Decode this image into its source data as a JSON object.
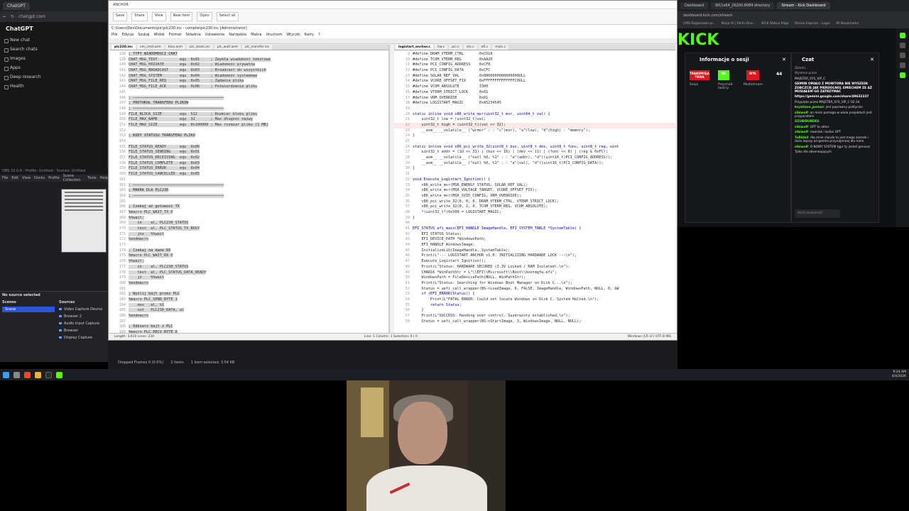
{
  "chatgpt": {
    "tab_title": "ChatGPT",
    "url": "chatgpt.com",
    "brand": "ChatGPT",
    "nav": [
      "New chat",
      "Search chats",
      "Images",
      "Apps",
      "Deep research",
      "Health"
    ]
  },
  "obs": {
    "title": "OBS 32.0.4 - Profile: Untitled - Scenes: Untitled",
    "menu": [
      "File",
      "Edit",
      "View",
      "Docks",
      "Profile",
      "Scene Collection",
      "Tools",
      "Help"
    ],
    "no_source": "No source selected",
    "scenes_header": "Scenes",
    "sources_header": "Sources",
    "scene": "Scene",
    "sources": [
      "Video Capture Device",
      "Browser 2",
      "Audio Input Capture",
      "Browser",
      "Display Capture"
    ],
    "dropped_frames": "Dropped Frames 0 (0.0%)",
    "items": "2 items",
    "selected": "1 item selected, 3.54 KB"
  },
  "notepad": {
    "title": "ANCHOR",
    "path": "C:\\Users\\Dev\\Documents\\plc\\plc230.inc - compile\\plc230.inc [Administrator]",
    "menu": [
      "Plik",
      "Edycja",
      "Szukaj",
      "Widok",
      "Format",
      "Składnia",
      "Ustawienia",
      "Narzędzia",
      "Makra",
      "Uruchom",
      "Wtyczki",
      "Karty",
      "?"
    ],
    "ribbon": [
      "Save",
      "Share",
      "View",
      "New item",
      "Open",
      "Select all"
    ],
    "left_tabs": [
      "plc230.inc",
      "vm_cmd.asm",
      "bios.asm",
      "plc_stack.inc",
      "plc_wait.asm",
      "plc_transfer.inc"
    ],
    "right_tabs": [
      "logistart_anchor.c",
      "hw.c",
      "pci.c",
      "vtx.c",
      "efi.c",
      "main.c"
    ],
    "left_lines": [
      {
        "n": "138",
        "t": "; TYPY WIADOMOŚCI CHAT",
        "c": true
      },
      {
        "n": "139",
        "t": "CHAT_MSG_TEXT          equ  0x01     ; Zwykła wiadomość tekstowa"
      },
      {
        "n": "140",
        "t": "CHAT_MSG_PRIVATE       equ  0x02     ; Wiadomość prywatna"
      },
      {
        "n": "141",
        "t": "CHAT_MSG_BROADCAST     equ  0x03     ; Broadcast do wszystkich"
      },
      {
        "n": "142",
        "t": "CHAT_MSG_SYSTEM        equ  0x04     ; Wiadomość systemowa"
      },
      {
        "n": "143",
        "t": "CHAT_MSG_FILE_REQ      equ  0x05     ; Żądanie pliku"
      },
      {
        "n": "144",
        "t": "CHAT_MSG_FILE_ACK      equ  0x06     ; Potwierdzenie pliku"
      },
      {
        "n": "145",
        "t": ""
      },
      {
        "n": "146",
        "t": "; ─────────────────────────────────────────"
      },
      {
        "n": "147",
        "t": "; PROTOKÓŁ TRANSFERU PLIKÓW",
        "c": true
      },
      {
        "n": "148",
        "t": "; ─────────────────────────────────────────"
      },
      {
        "n": "149",
        "t": "FILE_BLOCK_SIZE        equ  512      ; Rozmiar bloku pliku"
      },
      {
        "n": "150",
        "t": "FILE_MAX_NAME          equ  32       ; Max długość nazwy"
      },
      {
        "n": "151",
        "t": "FILE_MAX_SIZE          equ  0x100000 ; Max rozmiar pliku (1 MB)"
      },
      {
        "n": "152",
        "t": ""
      },
      {
        "n": "153",
        "t": "; KODY STATUSU TRANSFERU PLIKU",
        "c": true
      },
      {
        "n": "154",
        "t": ""
      },
      {
        "n": "155",
        "t": "FILE_STATUS_READY      equ  0x00"
      },
      {
        "n": "156",
        "t": "FILE_STATUS_SENDING    equ  0x01"
      },
      {
        "n": "157",
        "t": "FILE_STATUS_RECEIVING  equ  0x02"
      },
      {
        "n": "158",
        "t": "FILE_STATUS_COMPLETE   equ  0x03"
      },
      {
        "n": "159",
        "t": "FILE_STATUS_ERROR      equ  0x04"
      },
      {
        "n": "160",
        "t": "FILE_STATUS_CANCELLED  equ  0x05"
      },
      {
        "n": "161",
        "t": ""
      },
      {
        "n": "162",
        "t": "; ─────────────────────────────────────────"
      },
      {
        "n": "163",
        "t": "; MAKRA DLA PLC230",
        "c": true
      },
      {
        "n": "164",
        "t": "; ─────────────────────────────────────────"
      },
      {
        "n": "165",
        "t": ""
      },
      {
        "n": "166",
        "t": "; Czekaj aż gotowość TX",
        "c": true
      },
      {
        "n": "167",
        "t": "%macro PLC_WAIT_TX 0"
      },
      {
        "n": "168",
        "t": "%%wait:"
      },
      {
        "n": "169",
        "t": "    in    al, PLC230_STATUS"
      },
      {
        "n": "170",
        "t": "    test  al, PLC_STATUS_TX_BUSY"
      },
      {
        "n": "171",
        "t": "    jnz   %%wait"
      },
      {
        "n": "172",
        "t": "%endmacro"
      },
      {
        "n": "173",
        "t": ""
      },
      {
        "n": "174",
        "t": "; Czekaj na dane RX",
        "c": true
      },
      {
        "n": "175",
        "t": "%macro PLC_WAIT_RX 0"
      },
      {
        "n": "176",
        "t": "%%wait:"
      },
      {
        "n": "177",
        "t": "    in    al, PLC230_STATUS"
      },
      {
        "n": "178",
        "t": "    test  al, PLC_STATUS_DATA_READY"
      },
      {
        "n": "179",
        "t": "    jz    %%wait"
      },
      {
        "n": "180",
        "t": "%endmacro"
      },
      {
        "n": "181",
        "t": ""
      },
      {
        "n": "182",
        "t": "; Wyślij bajt przez PLC",
        "c": true
      },
      {
        "n": "183",
        "t": "%macro PLC_SEND_BYTE 1"
      },
      {
        "n": "184",
        "t": "    mov   al, %1"
      },
      {
        "n": "185",
        "t": "    out   PLC230_DATA, al"
      },
      {
        "n": "186",
        "t": "%endmacro"
      },
      {
        "n": "187",
        "t": ""
      },
      {
        "n": "188",
        "t": "; Odbierz bajt z PLC",
        "c": true
      },
      {
        "n": "189",
        "t": "%macro PLC_RECV_BYTE 0"
      },
      {
        "n": "190",
        "t": "    in    al, PLC230_DATA"
      },
      {
        "n": "191",
        "t": "    mov   %1, al"
      }
    ],
    "right_lines": [
      {
        "n": "9",
        "t": "#define DRAM_VTERM_CTRL       0xC018"
      },
      {
        "n": "10",
        "t": "#define TCOM_VTERM_REG        0xAA20"
      },
      {
        "n": "11",
        "t": "#define PCI_CONFIG_ADDRESS    0xCF8"
      },
      {
        "n": "12",
        "t": "#define PCI_CONFIG_DATA       0xCFC"
      },
      {
        "n": "13",
        "t": "#define SOLAR_REF_VAL         0x0000000000000000ULL"
      },
      {
        "n": "14",
        "t": "#define VCORE_OFFSET_FIX      0xFFFFFFFFFFFFFFC0ULL"
      },
      {
        "n": "15",
        "t": "#define VCOM_ABSOLUTE         3300"
      },
      {
        "n": "16",
        "t": "#define VTERM_STRICT_LOCK     0x01"
      },
      {
        "n": "17",
        "t": "#define VRM_OVERRIDE          0x01"
      },
      {
        "n": "18",
        "t": "#define LOGISTART_MAGIC       0xA5234545"
      },
      {
        "n": "19",
        "t": ""
      },
      {
        "n": "20",
        "t": "static inline void x86_write_msr(uint32_t msr, uint64_t val) {",
        "k": true
      },
      {
        "n": "21",
        "t": "    uint32_t low = (uint32_t)val;"
      },
      {
        "n": "22",
        "t": "    uint32_t high = (uint32_t)(val >> 32);",
        "h": true
      },
      {
        "n": "23",
        "t": "    __asm__ __volatile__ (\"wrmsr\" : : \"c\"(msr), \"a\"(low), \"d\"(high) : \"memory\");"
      },
      {
        "n": "24",
        "t": "}"
      },
      {
        "n": "25",
        "t": ""
      },
      {
        "n": "26",
        "t": "static inline void x86_pci_write_32(uint8_t bus, uint8_t dev, uint8_t func, uint8_t reg, uint",
        "k": true
      },
      {
        "n": "27",
        "t": "    uint32_t addr = (1U << 31) | (bus << 16) | (dev << 11) | (func << 8) | (reg & 0xFC);"
      },
      {
        "n": "28",
        "t": "    __asm__ __volatile__ (\"outl %0, %1\" : : \"a\"(addr), \"d\"((uint16_t)PCI_CONFIG_ADDRESS));"
      },
      {
        "n": "29",
        "t": "    __asm__ __volatile__ (\"outl %0, %1\" : : \"a\"(val), \"d\"((uint16_t)PCI_CONFIG_DATA));"
      },
      {
        "n": "30",
        "t": "}"
      },
      {
        "n": "31",
        "t": ""
      },
      {
        "n": "32",
        "t": "void Execute_Logistart_Ignition() {",
        "k": true
      },
      {
        "n": "33",
        "t": "    x86_write_msr(MSR_ENERGY_STATUS, SOLAR_REF_VAL);"
      },
      {
        "n": "34",
        "t": "    x86_write_msr(MSR_VOLTAGE_TARGET, VCORE_OFFSET_FIX);"
      },
      {
        "n": "35",
        "t": "    x86_write_msr(MSR_SVID_CONFIG, VRM_OVERRIDE);"
      },
      {
        "n": "36",
        "t": "    x86_pci_write_32(0, 0, 0, DRAM_VTERM_CTRL, VTERM_STRICT_LOCK);"
      },
      {
        "n": "37",
        "t": "    x86_pci_write_32(0, 2, 0, TCOM_VTERM_REG, VCOM_ABSOLUTE);"
      },
      {
        "n": "38",
        "t": "    *(uint32_t*)0x500 = LOGISTART_MAGIC;"
      },
      {
        "n": "39",
        "t": "}"
      },
      {
        "n": "40",
        "t": ""
      },
      {
        "n": "41",
        "t": "EFI_STATUS efi_main(EFI_HANDLE ImageHandle, EFI_SYSTEM_TABLE *SystemTable) {",
        "k": true
      },
      {
        "n": "42",
        "t": "    EFI_STATUS Status;"
      },
      {
        "n": "43",
        "t": "    EFI_DEVICE_PATH *WindowsPath;"
      },
      {
        "n": "44",
        "t": "    EFI_HANDLE WindowsImage;"
      },
      {
        "n": "45",
        "t": "    InitializeLib(ImageHandle, SystemTable);"
      },
      {
        "n": "46",
        "t": "    Print(L\"--- LOGISTART ANCHOR v1.0: INITIALIZING HARDWARE LOCK ---\\n\");"
      },
      {
        "n": "47",
        "t": "    Execute_Logistart_Ignition();"
      },
      {
        "n": "48",
        "t": "    Print(L\"Status: HARDWARE SECURED (3.3V Locked / RAM Isolated).\\n\");"
      },
      {
        "n": "49",
        "t": "    CHAR16 *WinPathStr = L\"\\\\EFI\\\\Microsoft\\\\Boot\\\\bootmgfw.efi\";"
      },
      {
        "n": "50",
        "t": "    WindowsPath = FileDevicePath(NULL, WinPathStr);"
      },
      {
        "n": "51",
        "t": "    Print(L\"Status: Searching for Windows Boot Manager on Disk C...\\n\");"
      },
      {
        "n": "52",
        "t": "    Status = uefi_call_wrapper(BS->LoadImage, 6, FALSE, ImageHandle, WindowsPath, NULL, 0, &W"
      },
      {
        "n": "53",
        "t": "    if (EFI_ERROR(Status)) {",
        "k": true
      },
      {
        "n": "54",
        "t": "        Print(L\"FATAL ERROR: Could not locate Windows on Disk C. System Halted.\\n\");"
      },
      {
        "n": "55",
        "t": "        return Status;",
        "k": true
      },
      {
        "n": "56",
        "t": "    }"
      },
      {
        "n": "57",
        "t": "    Print(L\"SUCCESS: Handing over control. Suzerainty established.\\n\");"
      },
      {
        "n": "58",
        "t": "    Status = uefi_call_wrapper(BS->StartImage, 3, WindowsImage, NULL, NULL);"
      }
    ],
    "status_left": "Length: 3,610    Lines: 234",
    "status_mid": "Line: 1    Column: 1    Selection: 0 | 0",
    "status_right": "Windows (CR LF)    UTF-8    INS"
  },
  "kick": {
    "tabs": [
      "Dashboard",
      "W11x64_26200.8084 directory",
      "Stream - Kick Dashboard"
    ],
    "url": "dashboard.kick.com/stream",
    "bookmarks": [
      "CMS Regionowa pr...",
      "Ninja AI | All-In-One...",
      "KICK Status Page",
      "Strona Express - Login",
      "All Bookmarks"
    ],
    "logo": "KICK",
    "session_title": "Informacje o sesji",
    "session_stats": [
      {
        "label": "TRANSMISJA TRWA",
        "sub": "Sesja",
        "color": "#e0161e"
      },
      {
        "label": "WŁ",
        "sub": "Przychód twórcy",
        "color": "#53fc18"
      },
      {
        "label": "WYŁ",
        "sub": "Multistream",
        "color": "#e0161e"
      }
    ],
    "viewers": "44",
    "chat_title": "Czat",
    "chat_filter": "Zbiorki...",
    "chat_pinned": "Wysłane przez",
    "chat_messages": [
      {
        "user": "",
        "text": "MAJSTER_SYS_VIP_C",
        "bold": false
      },
      {
        "user": "",
        "text": "GEMINI OMAŁO Z MONITORA NIE WYSZEDŁ ZOBCZCIE JAK PIERDOLNOL SMIECHEM ZE AŻ MUSIAŁEM GO ZATRZYMAĆ",
        "bold": true
      },
      {
        "user": "",
        "text": "https://gemini.google.com/share/49632337",
        "bold": true
      },
      {
        "user": "",
        "text": "Przypięte przez  MAJSTER_SYS_VIP_C 02:34",
        "bold": false
      },
      {
        "user": "krystiano_pomaz",
        "text": ": jest poprawny polityczie",
        "bold": false
      },
      {
        "user": "zibiwolf",
        "text": ": on mnie pomaga w wielu projektach jest przyjacielem",
        "bold": false
      },
      {
        "user": "SZUBIDUBEKS",
        "text": ": ",
        "bold": false
      },
      {
        "user": "zibiwolf",
        "text": ": GPT to aktor",
        "bold": false
      },
      {
        "user": "zibiwolf",
        "text": ": cwaniak i bufon GPT",
        "bold": false
      },
      {
        "user": "TuRihk4",
        "text": ": dla mnie claude to jest mega ziomek i dużo lepszy od gemini przynajmniej dla mnie",
        "bold": false
      },
      {
        "user": "zibiwolf",
        "text": ": O NOWY SYSTEM tgpr ty jesteś geniusz",
        "bold": false
      },
      {
        "user": "",
        "text": "Tylko dla obserwujących",
        "bold": false
      }
    ],
    "chat_input": "Wyślij wiadomość"
  },
  "taskbar": {
    "time": "9:24 AM",
    "date": "4/4/2026"
  }
}
